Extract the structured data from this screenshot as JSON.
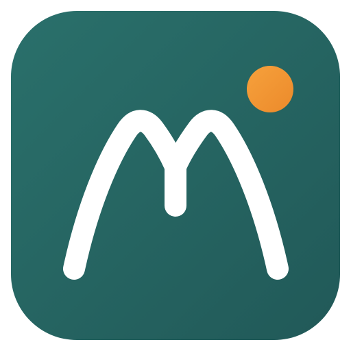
{
  "app_icon": {
    "icon_name": "m-mountain-logo-icon",
    "colors": {
      "background_gradient_start": "#2a706b",
      "background_gradient_end": "#215958",
      "glyph": "#ffffff",
      "dot_gradient_start": "#f6a13c",
      "dot_gradient_end": "#ec8a2b"
    }
  }
}
